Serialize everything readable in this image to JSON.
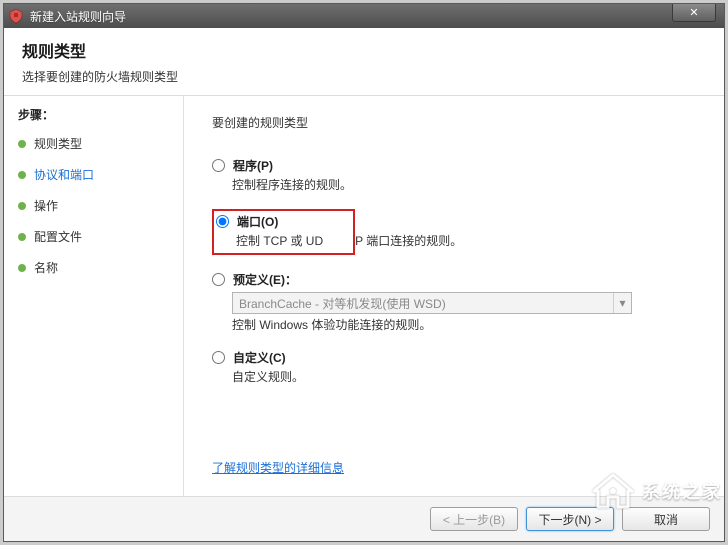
{
  "window": {
    "title": "新建入站规则向导"
  },
  "header": {
    "title": "规则类型",
    "subtitle": "选择要创建的防火墙规则类型"
  },
  "sidebar": {
    "steps_label": "步骤：",
    "steps": [
      {
        "label": "规则类型",
        "current": false
      },
      {
        "label": "协议和端口",
        "current": true
      },
      {
        "label": "操作",
        "current": false
      },
      {
        "label": "配置文件",
        "current": false
      },
      {
        "label": "名称",
        "current": false
      }
    ]
  },
  "content": {
    "prompt": "要创建的规则类型",
    "options": [
      {
        "id": "program",
        "label": "程序(P)",
        "desc": "控制程序连接的规则。",
        "checked": false
      },
      {
        "id": "port",
        "label": "端口(O)",
        "desc": "控制 TCP 或 UDP 端口连接的规则。",
        "checked": true,
        "highlight": true,
        "desc_pre": "控制 TCP 或 UD",
        "desc_post": "P 端口连接的规则。"
      },
      {
        "id": "predefined",
        "label": "预定义(E)：",
        "desc": "控制 Windows 体验功能连接的规则。",
        "checked": false,
        "combo": "BranchCache - 对等机发现(使用 WSD)"
      },
      {
        "id": "custom",
        "label": "自定义(C)",
        "desc": "自定义规则。",
        "checked": false
      }
    ],
    "learn_more": "了解规则类型的详细信息"
  },
  "footer": {
    "back": "< 上一步(B)",
    "next": "下一步(N) >",
    "cancel": "取消"
  },
  "watermark": {
    "text": "系统之家"
  }
}
